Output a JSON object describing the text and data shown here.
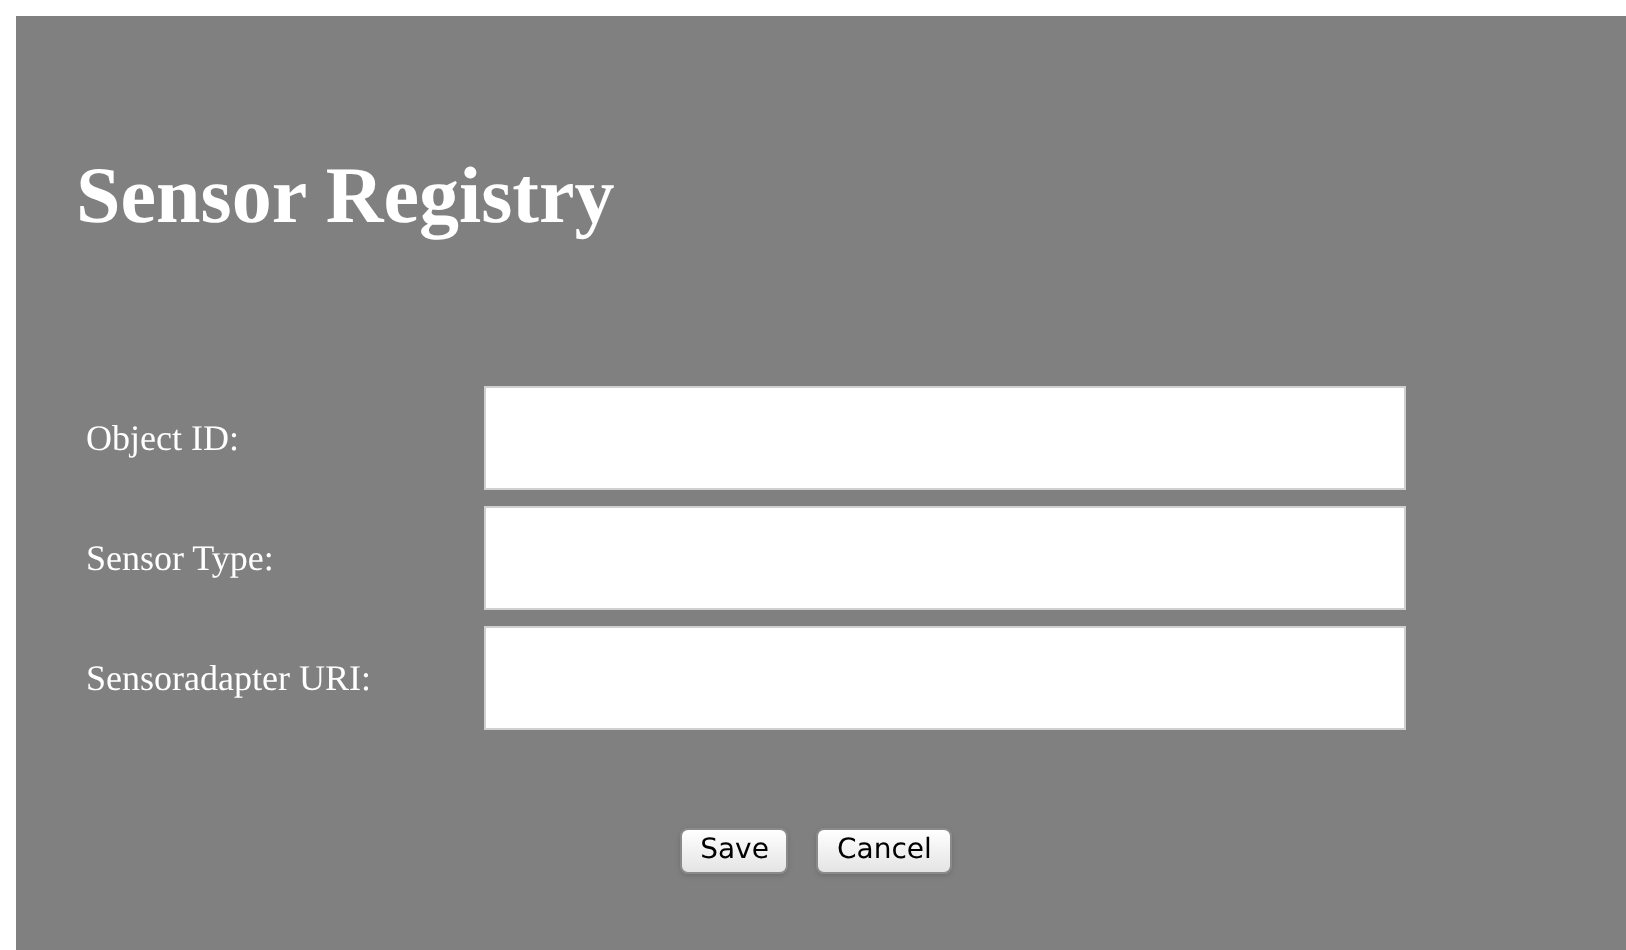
{
  "title": "Sensor Registry",
  "fields": [
    {
      "label": "Object ID:"
    },
    {
      "label": "Sensor Type:"
    },
    {
      "label": "Sensoradapter URI:"
    }
  ],
  "buttons": [
    "Save",
    "Cancel"
  ]
}
